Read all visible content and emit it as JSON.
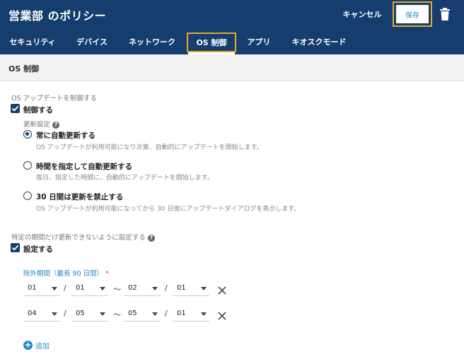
{
  "header": {
    "title": "営業部 のポリシー",
    "cancel_label": "キャンセル",
    "save_label": "保存"
  },
  "tabs": [
    {
      "label": "セキュリティ"
    },
    {
      "label": "デバイス"
    },
    {
      "label": "ネットワーク"
    },
    {
      "label": "OS 制御"
    },
    {
      "label": "アプリ"
    },
    {
      "label": "キオスクモード"
    }
  ],
  "active_tab": "OS 制御",
  "subheader": {
    "title": "OS 制御"
  },
  "os_update": {
    "section_label": "OS アップデートを制御する",
    "control_checkbox_label": "制御する",
    "control_checked": true,
    "settings_label": "更新設定",
    "options": [
      {
        "label": "常に自動更新する",
        "desc": "OS アップデートが利用可能になり次第、自動的にアップデートを開始します。",
        "checked": true
      },
      {
        "label": "時間を指定して自動更新する",
        "desc": "毎日、指定した時間に、自動的にアップデートを開始します。",
        "checked": false
      },
      {
        "label": "30 日間は更新を禁止する",
        "desc": "OS アップデートが利用可能になってから 30 日後にアップデートダイアログを表示します。",
        "checked": false
      }
    ]
  },
  "freeze": {
    "section_label": "特定の期間だけ更新できないように設定する",
    "set_checkbox_label": "設定する",
    "set_checked": true,
    "range_label": "除外期間（最長 90 日間）",
    "required_mark": "*",
    "separator_slash": "/",
    "separator_tilde": "〜",
    "ranges": [
      {
        "start_month": "01",
        "start_day": "01",
        "end_month": "02",
        "end_day": "01"
      },
      {
        "start_month": "04",
        "start_day": "05",
        "end_month": "05",
        "end_day": "01"
      }
    ],
    "add_label": "追加",
    "add_symbol": "+"
  },
  "colors": {
    "header_bg": "#153e6e",
    "accent": "#1f88c9",
    "highlight": "#e8a92a",
    "required": "#e0403f"
  },
  "icons": {
    "trash": "trash-icon",
    "help": "help-icon",
    "close": "close-icon",
    "checkbox": "checkmark-icon",
    "dropdown": "chevron-down-icon",
    "add": "add-circle-icon"
  }
}
